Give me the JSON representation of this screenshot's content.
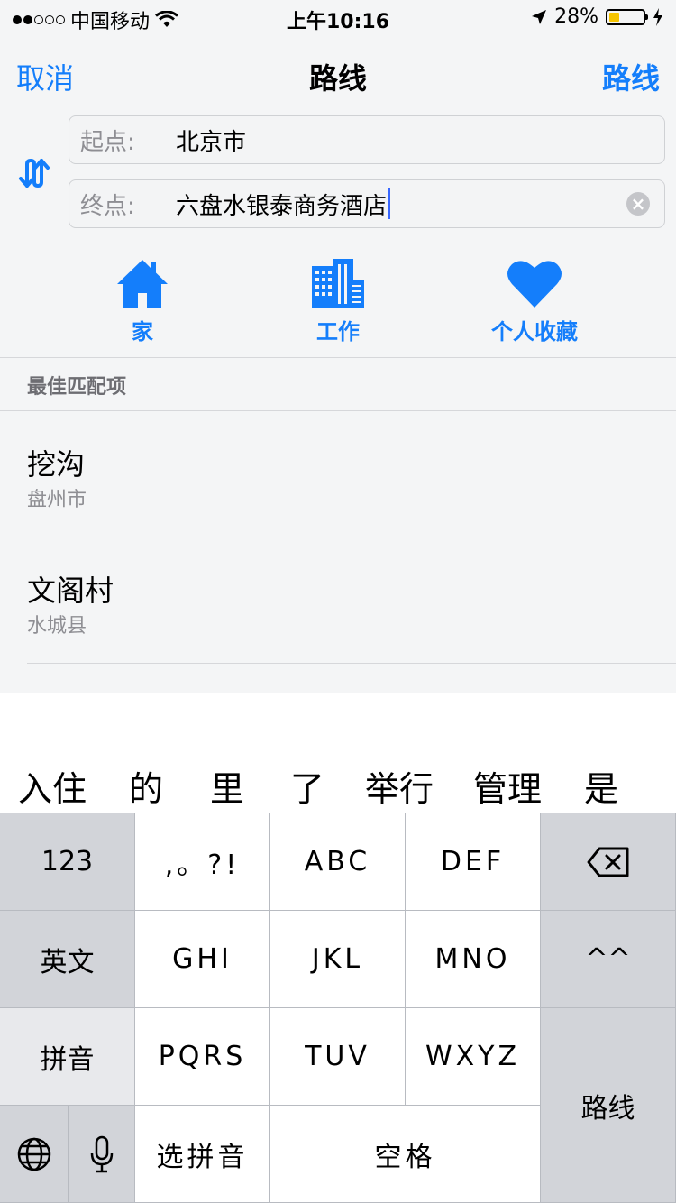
{
  "status_bar": {
    "carrier": "中国移动",
    "time": "上午10:16",
    "battery": "28%",
    "battery_level": 0.28
  },
  "nav": {
    "cancel": "取消",
    "title": "路线",
    "route": "路线"
  },
  "route_fields": {
    "start_label": "起点:",
    "start_value": "北京市",
    "end_label": "终点:",
    "end_value": "六盘水银泰商务酒店"
  },
  "shortcuts": [
    {
      "label": "家",
      "icon": "house-icon"
    },
    {
      "label": "工作",
      "icon": "building-icon"
    },
    {
      "label": "个人收藏",
      "icon": "heart-icon"
    }
  ],
  "results_header": "最佳匹配项",
  "results": [
    {
      "title": "挖沟",
      "subtitle": "盘州市"
    },
    {
      "title": "文阁村",
      "subtitle": "水城县"
    }
  ],
  "candidates": [
    "入住",
    "的",
    "里",
    "了",
    "举行",
    "管理",
    "是"
  ],
  "keyboard": {
    "row1": [
      "123",
      ",。?!",
      "ABC",
      "DEF"
    ],
    "row2": [
      "英文",
      "GHI",
      "JKL",
      "MNO",
      "^^"
    ],
    "row3": [
      "拼音",
      "PQRS",
      "TUV",
      "WXYZ"
    ],
    "row4": [
      "选拼音",
      "空格"
    ],
    "enter": "路线"
  },
  "colors": {
    "accent": "#147efb",
    "caret": "#3867ff"
  }
}
